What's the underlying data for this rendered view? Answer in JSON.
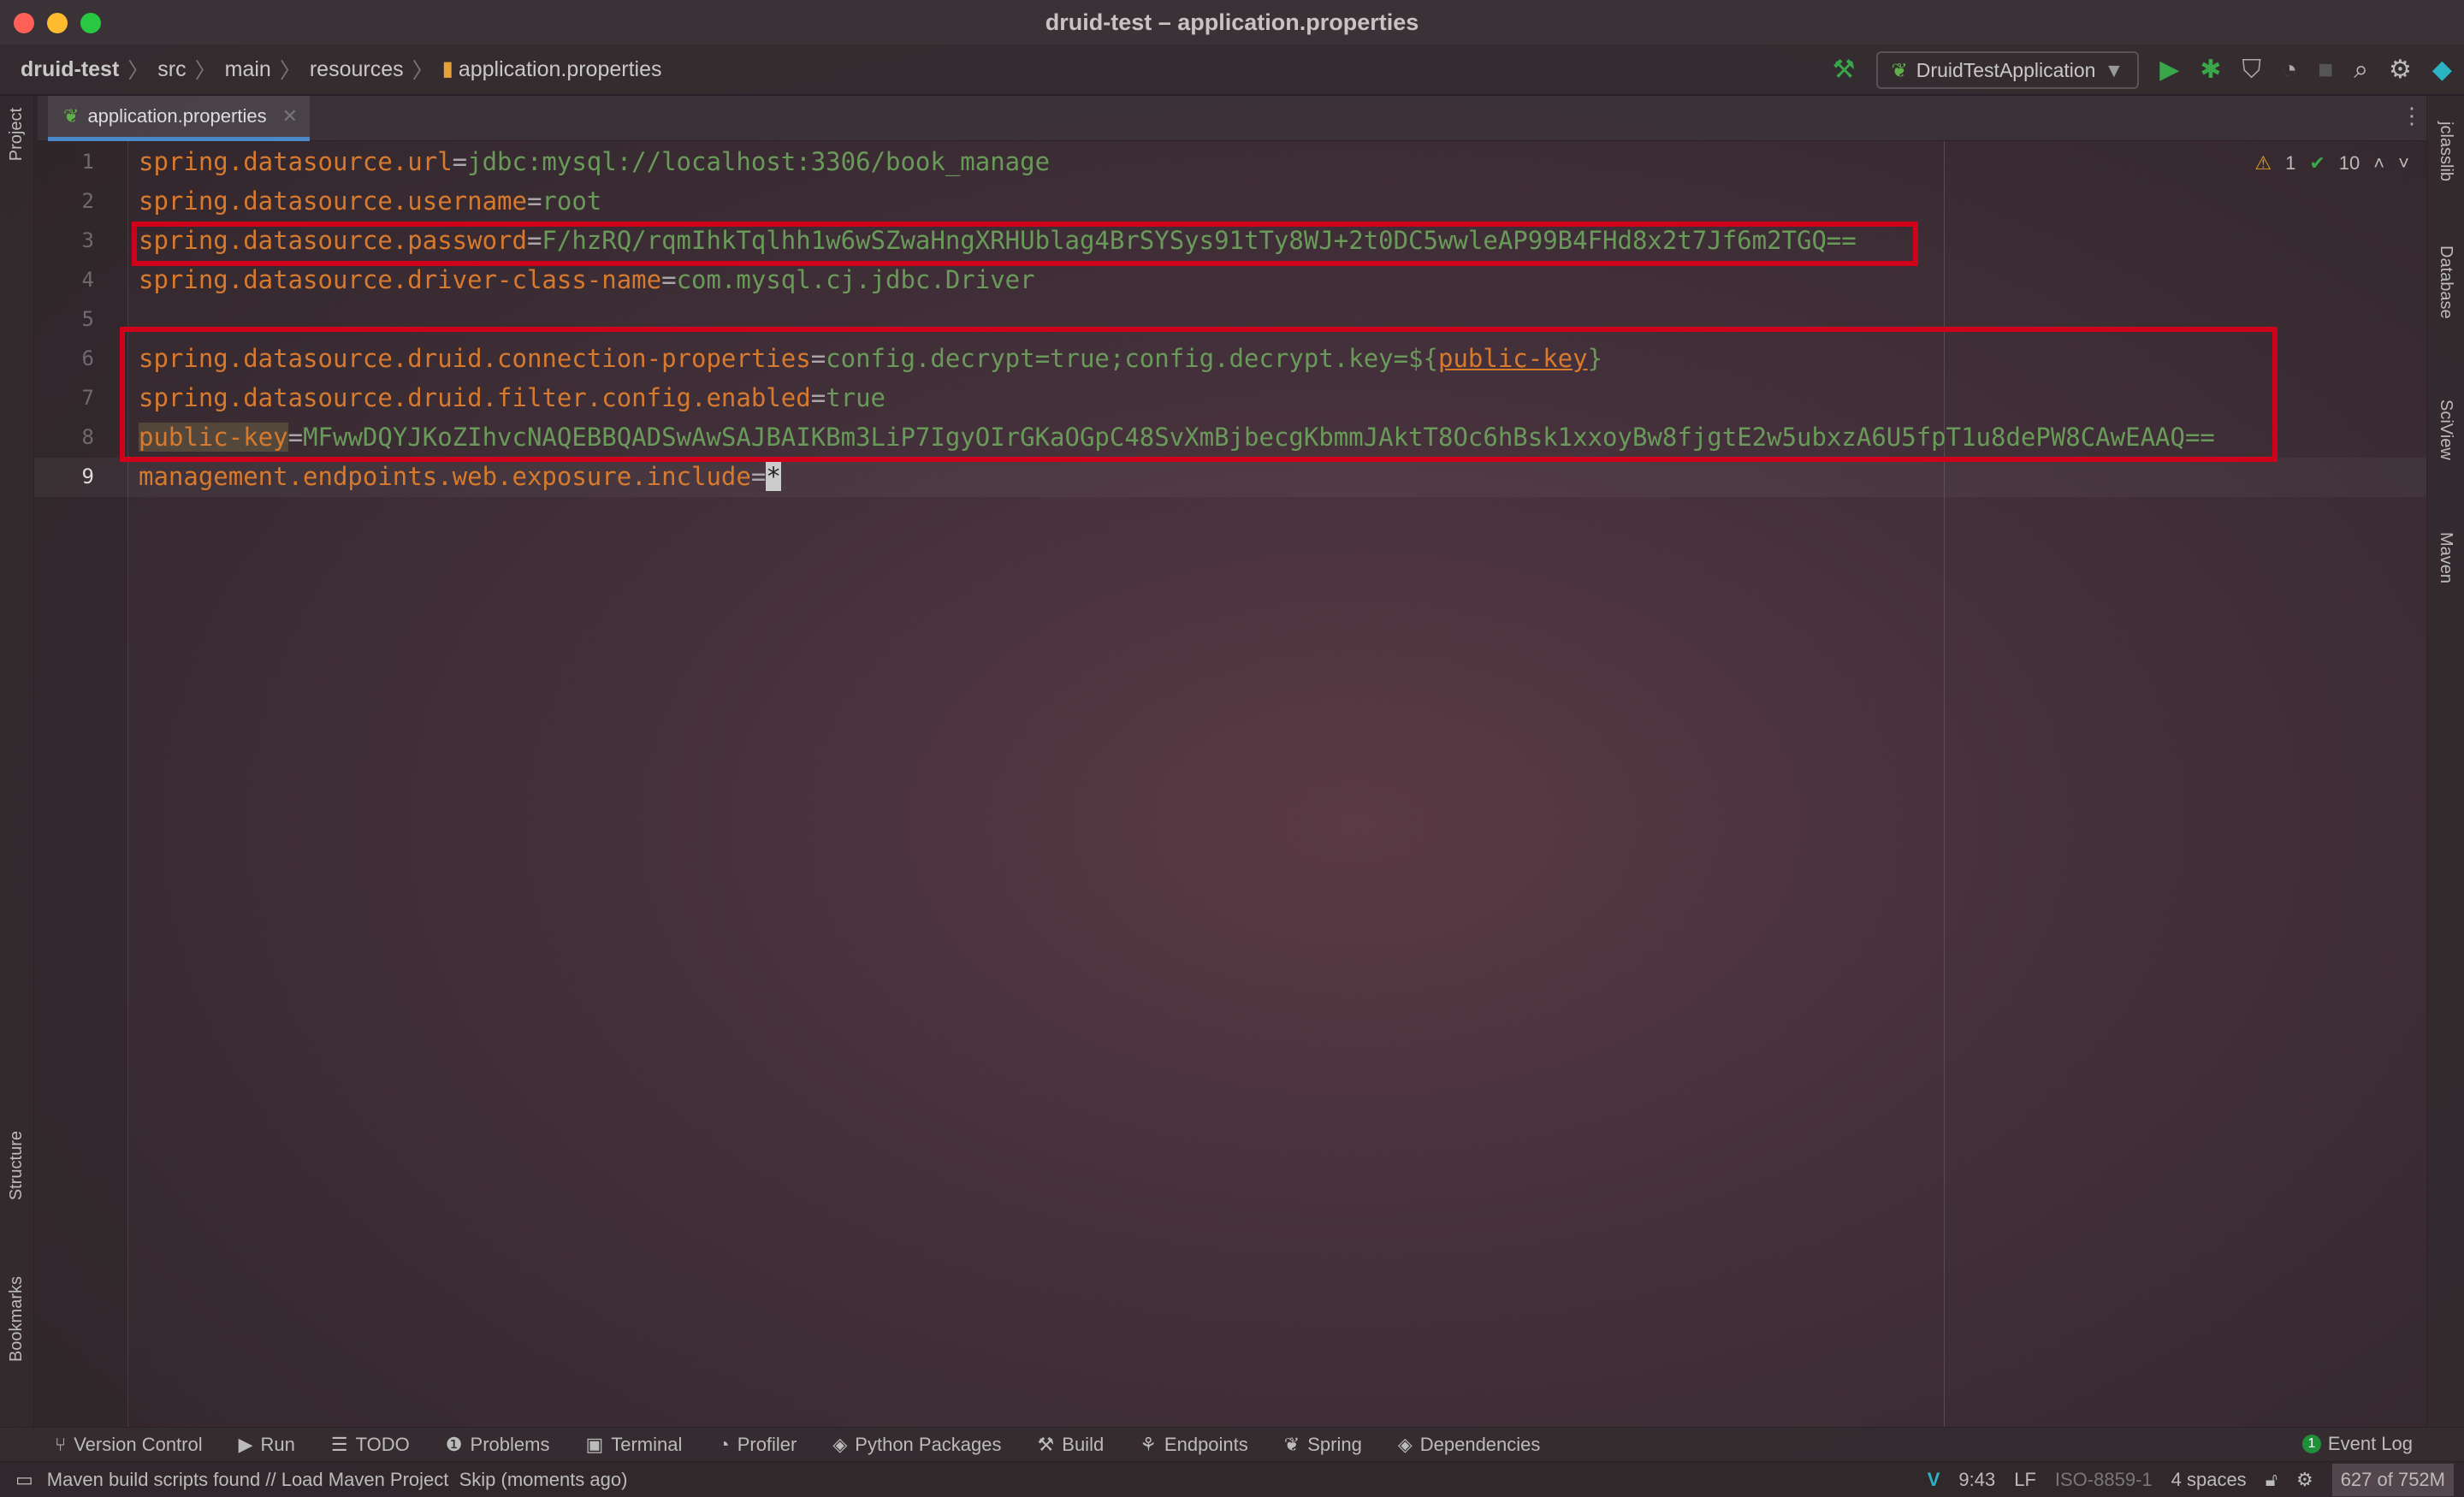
{
  "window": {
    "title": "druid-test – application.properties"
  },
  "breadcrumb": [
    "druid-test",
    "src",
    "main",
    "resources",
    "application.properties"
  ],
  "toolbar": {
    "run_config": "DruidTestApplication"
  },
  "tabs": [
    {
      "label": "application.properties",
      "active": true
    }
  ],
  "left_strip": [
    "Project",
    "Structure",
    "Bookmarks"
  ],
  "right_strip": [
    "jclasslib",
    "Database",
    "SciView",
    "Maven"
  ],
  "inspections": {
    "warnings": "1",
    "ok": "10"
  },
  "editor": {
    "lines": [
      {
        "n": "1",
        "key": "spring.datasource.url",
        "eq": "=",
        "val": "jdbc:mysql://localhost:3306/book_manage"
      },
      {
        "n": "2",
        "key": "spring.datasource.username",
        "eq": "=",
        "val": "root"
      },
      {
        "n": "3",
        "key": "spring.datasource.password",
        "eq": "=",
        "val": "F/hzRQ/rqmIhkTqlhh1w6wSZwaHngXRHUblag4BrSYSys91tTy8WJ+2t0DC5wwleAP99B4FHd8x2t7Jf6m2TGQ=="
      },
      {
        "n": "4",
        "key": "spring.datasource.driver-class-name",
        "eq": "=",
        "val": "com.mysql.cj.jdbc.Driver"
      },
      {
        "n": "5",
        "key": "",
        "eq": "",
        "val": ""
      },
      {
        "n": "6",
        "key": "spring.datasource.druid.connection-properties",
        "eq": "=",
        "val": "config.decrypt=true;config.decrypt.key=${",
        "ref": "public-key",
        "tail": "}"
      },
      {
        "n": "7",
        "key": "spring.datasource.druid.filter.config.enabled",
        "eq": "=",
        "val": "true"
      },
      {
        "n": "8",
        "key": "public-key",
        "eq": "=",
        "val": "MFwwDQYJKoZIhvcNAQEBBQADSwAwSAJBAIKBm3LiP7IgyOIrGKaOGpC48SvXmBjbecgKbmmJAktT8Oc6hBsk1xxoyBw8fjgtE2w5ubxzA6U5fpT1u8dePW8CAwEAAQ=="
      },
      {
        "n": "9",
        "key": "management.endpoints.web.exposure.include",
        "eq": "=",
        "val": "*"
      }
    ]
  },
  "tool_windows": [
    "Version Control",
    "Run",
    "TODO",
    "Problems",
    "Terminal",
    "Profiler",
    "Python Packages",
    "Build",
    "Endpoints",
    "Spring",
    "Dependencies"
  ],
  "event_log": {
    "label": "Event Log",
    "count": "1"
  },
  "status": {
    "message": "Maven build scripts found // Load Maven Project  Skip (moments ago)",
    "position": "9:43",
    "line_sep": "LF",
    "encoding": "ISO-8859-1",
    "indent": "4 spaces",
    "memory": "627 of 752M"
  },
  "colors": {
    "highlight_box": "#d0021b",
    "key": "#d77a2e",
    "value": "#6a9a5a",
    "tab_underline": "#4a88c7"
  }
}
